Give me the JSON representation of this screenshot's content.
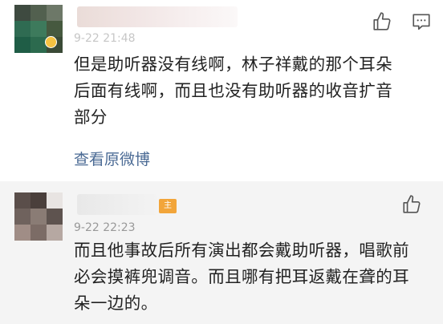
{
  "comments": [
    {
      "time": "9-22 21:48",
      "text_lines": [
        "但是助听器没有线啊，林子祥戴的那个耳朵",
        "后面有线啊，而且也没有助听器的收音扩音",
        "部分"
      ],
      "view_original": "查看原微博"
    },
    {
      "time": "9-22 22:23",
      "badge": "主",
      "text_lines": [
        "而且他事故后所有演出都会戴助听器，唱歌前",
        "必会摸裤兜调音。而且哪有把耳返戴在聋的耳",
        "朵一边的。"
      ]
    }
  ],
  "icons": {
    "like": "thumbs-up-icon",
    "reply": "comment-bubble-icon",
    "verified": "badge-dot-icon"
  },
  "colors": {
    "link": "#4a6a94",
    "owner_badge": "#f2a53a",
    "secondary_background": "#f4f4f4"
  }
}
